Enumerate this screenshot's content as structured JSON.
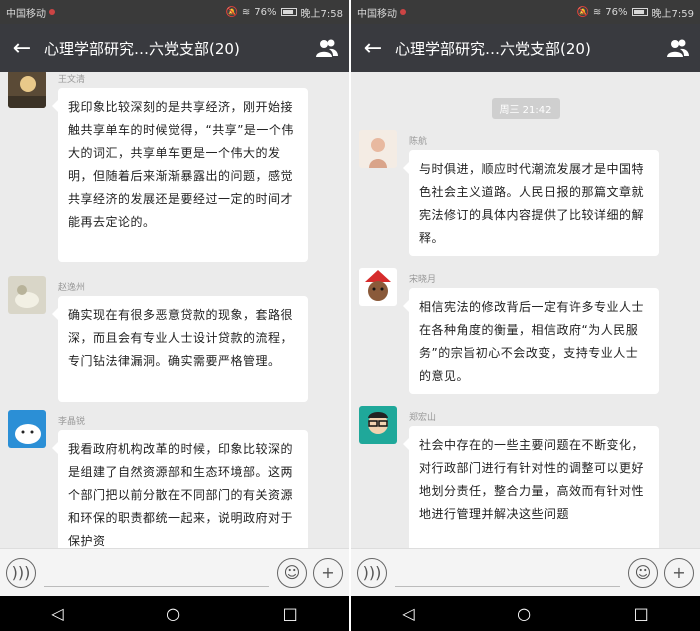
{
  "left": {
    "status": {
      "carrier": "中国移动",
      "battery": "76%",
      "time": "晚上7:58"
    },
    "header": {
      "title": "心理学部研究…六党支部(20)"
    },
    "messages": [
      {
        "sender": "王文清",
        "text": "我印象比较深刻的是共享经济，刚开始接触共享单车的时候觉得，“共享”是一个伟大的词汇，共享单车更是一个伟大的发明，但随着后来渐渐暴露出的问题，感觉共享经济的发展还是要经过一定的时间才能再去定论的。"
      },
      {
        "sender": "赵逸州",
        "text": "确实现在有很多恶意贷款的现象，套路很深，而且会有专业人士设计贷款的流程，专门钻法律漏洞。确实需要严格管理。"
      },
      {
        "sender": "李晶锐",
        "text": "我看政府机构改革的时候，印象比较深的是组建了自然资源部和生态环境部。这两个部门把以前分散在不同部门的有关资源和环保的职责都统一起来，说明政府对于保护资"
      }
    ]
  },
  "right": {
    "status": {
      "carrier": "中国移动",
      "battery": "76%",
      "time": "晚上7:59"
    },
    "header": {
      "title": "心理学部研究…六党支部(20)"
    },
    "timestamp": "周三 21:42",
    "messages": [
      {
        "sender": "陈航",
        "text": "与时俱进，顺应时代潮流发展才是中国特色社会主义道路。人民日报的那篇文章就宪法修订的具体内容提供了比较详细的解释。"
      },
      {
        "sender": "宋晓月",
        "text": "相信宪法的修改背后一定有许多专业人士在各种角度的衡量，相信政府“为人民服务”的宗旨初心不会改变，支持专业人士的意见。"
      },
      {
        "sender": "郑宏山",
        "text": "社会中存在的一些主要问题在不断变化，对行政部门进行有针对性的调整可以更好地划分责任，整合力量，高效而有针对性地进行管理并解决这些问题"
      }
    ]
  },
  "icons": {
    "back": "←",
    "voice": "voice-icon",
    "emoji": "emoji-icon",
    "plus": "+",
    "nav_back": "◁",
    "nav_home": "○",
    "nav_recent": "□"
  },
  "colors": {
    "titlebar": "#393a3f",
    "chat_bg": "#ebebeb",
    "bubble": "#ffffff"
  }
}
